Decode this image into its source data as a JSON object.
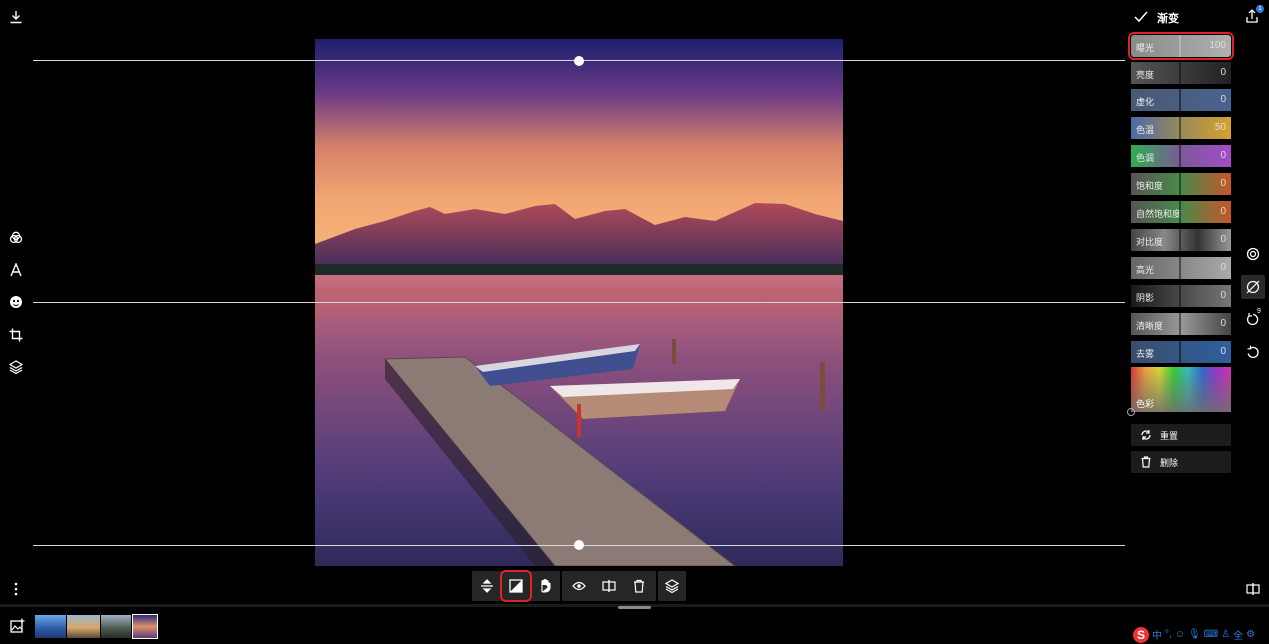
{
  "panel": {
    "title": "渐变",
    "sliders": [
      {
        "label": "曝光",
        "value": "100"
      },
      {
        "label": "亮度",
        "value": "0"
      },
      {
        "label": "虚化",
        "value": "0"
      },
      {
        "label": "色温",
        "value": "50"
      },
      {
        "label": "色调",
        "value": "0"
      },
      {
        "label": "饱和度",
        "value": "0"
      },
      {
        "label": "自然饱和度",
        "value": "0"
      },
      {
        "label": "对比度",
        "value": "0"
      },
      {
        "label": "高光",
        "value": "0"
      },
      {
        "label": "阴影",
        "value": "0"
      },
      {
        "label": "清晰度",
        "value": "0"
      },
      {
        "label": "去雾",
        "value": "0"
      }
    ],
    "color_label": "色彩",
    "reset_label": "重置",
    "delete_label": "删除"
  },
  "badges": {
    "share": "1",
    "history": "9"
  },
  "ime": {
    "logo": "S",
    "items": [
      "中",
      "°,",
      "☺",
      "🎙",
      "⌨",
      "♙",
      "全",
      "⚙"
    ]
  },
  "colors": {
    "highlight": "#e0202a",
    "panel_bg": "#000000"
  }
}
